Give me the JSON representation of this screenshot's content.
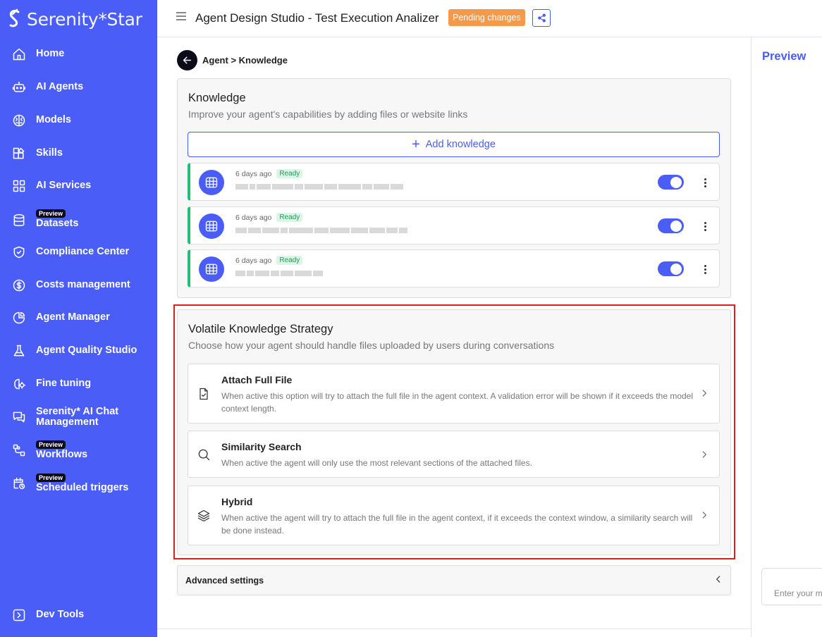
{
  "brand": {
    "name": "Serenity*Star",
    "color": "#4a5df7"
  },
  "sidebar": {
    "items": [
      {
        "label": "Home",
        "icon": "home-icon"
      },
      {
        "label": "AI Agents",
        "icon": "robot-icon"
      },
      {
        "label": "Models",
        "icon": "brain-icon"
      },
      {
        "label": "Skills",
        "icon": "skills-icon"
      },
      {
        "label": "AI Services",
        "icon": "grid-icon"
      },
      {
        "label": "Datasets",
        "icon": "database-icon",
        "badge": "Preview"
      },
      {
        "label": "Compliance Center",
        "icon": "shield-icon"
      },
      {
        "label": "Costs management",
        "icon": "dollar-icon"
      },
      {
        "label": "Agent Manager",
        "icon": "pie-chart-icon"
      },
      {
        "label": "Agent Quality Studio",
        "icon": "flask-icon"
      },
      {
        "label": "Fine tuning",
        "icon": "brain-settings-icon"
      },
      {
        "label": "Serenity* AI Chat Management",
        "icon": "chat-icon"
      },
      {
        "label": "Workflows",
        "icon": "workflow-icon",
        "badge": "Preview"
      },
      {
        "label": "Scheduled triggers",
        "icon": "calendar-clock-icon",
        "badge": "Preview"
      }
    ],
    "footer": {
      "label": "Dev Tools",
      "icon": "terminal-icon"
    }
  },
  "header": {
    "title": "Agent Design Studio - Test Execution Analizer",
    "pending_badge": "Pending changes",
    "share_icon": "share-icon"
  },
  "breadcrumb": "Agent > Knowledge",
  "knowledge": {
    "title": "Knowledge",
    "subtitle": "Improve your agent's capabilities by adding files or website links",
    "add_label": "Add knowledge",
    "items": [
      {
        "time": "6 days ago",
        "status": "Ready",
        "enabled": true
      },
      {
        "time": "6 days ago",
        "status": "Ready",
        "enabled": true
      },
      {
        "time": "6 days ago",
        "status": "Ready",
        "enabled": true
      }
    ]
  },
  "volatile": {
    "title": "Volatile Knowledge Strategy",
    "subtitle": "Choose how your agent should handle files uploaded by users during conversations",
    "options": [
      {
        "title": "Attach Full File",
        "desc": "When active this option will try to attach the full file in the agent context. A validation error will be shown if it exceeds the model context length.",
        "icon": "file-check-icon"
      },
      {
        "title": "Similarity Search",
        "desc": "When active the agent will only use the most relevant sections of the attached files.",
        "icon": "search-icon"
      },
      {
        "title": "Hybrid",
        "desc": "When active the agent will try to attach the full file in the agent context, if it exceeds the context window, a similarity search will be done instead.",
        "icon": "layers-icon"
      }
    ]
  },
  "advanced": {
    "label": "Advanced settings"
  },
  "preview": {
    "title": "Preview",
    "input_placeholder": "Enter your message"
  },
  "colors": {
    "accent": "#4a5df7",
    "ready": "#1fbf74",
    "pending": "#f59a4b",
    "highlight": "#e01d1d"
  }
}
